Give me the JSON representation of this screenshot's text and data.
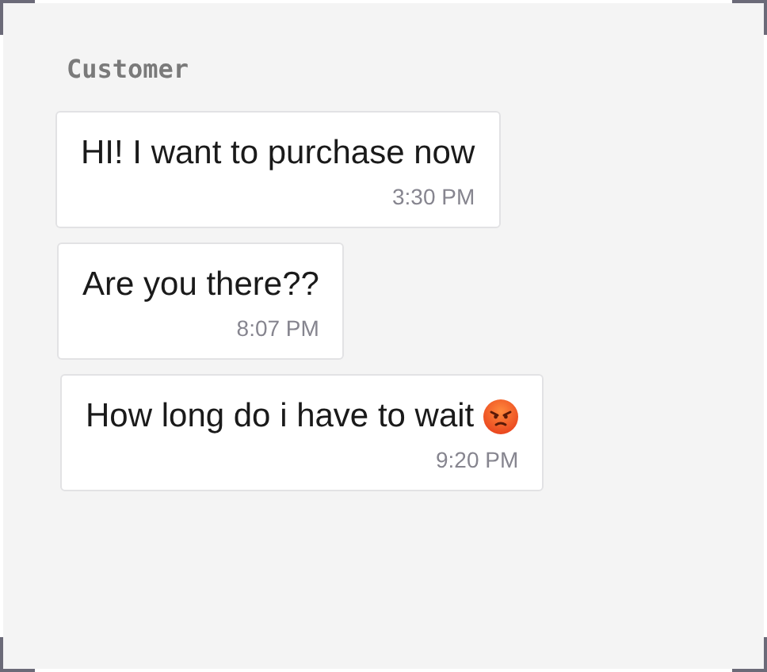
{
  "sender": "Customer",
  "messages": [
    {
      "text": "HI! I want to purchase now",
      "time": "3:30 PM"
    },
    {
      "text": "Are you there??",
      "time": "8:07 PM"
    },
    {
      "text": "How long do i have to wait",
      "time": "9:20 PM",
      "kind": "angry"
    }
  ]
}
